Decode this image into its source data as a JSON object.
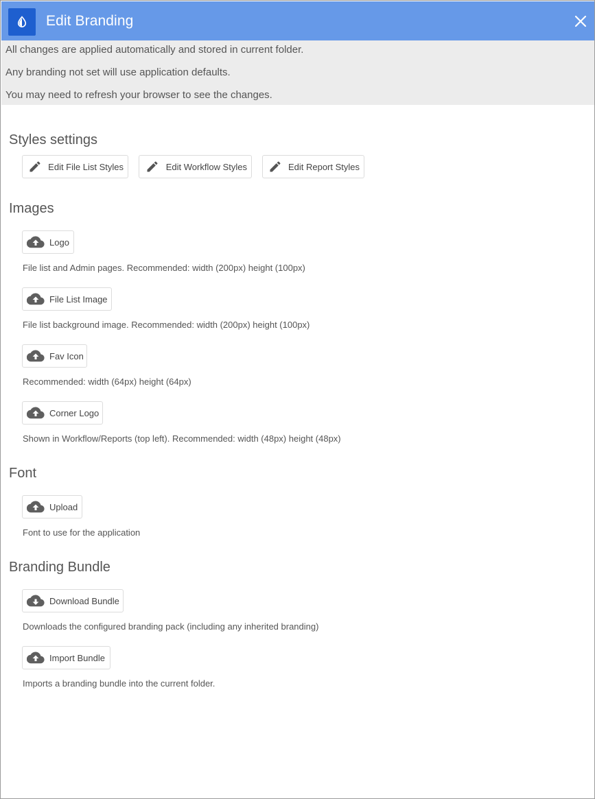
{
  "dialog": {
    "title": "Edit Branding",
    "app_icon": "water-drop-icon",
    "close_icon": "close-icon"
  },
  "notice": {
    "lines": [
      "All changes are applied automatically and stored in current folder.",
      "Any branding not set will use application defaults.",
      "You may need to refresh your browser to see the changes."
    ]
  },
  "styles": {
    "heading": "Styles settings",
    "buttons": [
      {
        "label": "Edit File List Styles",
        "icon": "pencil-icon"
      },
      {
        "label": "Edit Workflow Styles",
        "icon": "pencil-icon"
      },
      {
        "label": "Edit Report Styles",
        "icon": "pencil-icon"
      }
    ]
  },
  "images": {
    "heading": "Images",
    "items": [
      {
        "label": "Logo",
        "icon": "cloud-upload-icon",
        "hint": "File list and Admin pages. Recommended: width (200px) height (100px)"
      },
      {
        "label": "File List Image",
        "icon": "cloud-upload-icon",
        "hint": "File list background image. Recommended: width (200px) height (100px)"
      },
      {
        "label": "Fav Icon",
        "icon": "cloud-upload-icon",
        "hint": "Recommended: width (64px) height (64px)"
      },
      {
        "label": "Corner Logo",
        "icon": "cloud-upload-icon",
        "hint": "Shown in Workflow/Reports (top left). Recommended: width (48px) height (48px)"
      }
    ]
  },
  "font": {
    "heading": "Font",
    "items": [
      {
        "label": "Upload",
        "icon": "cloud-upload-icon",
        "hint": "Font to use for the application"
      }
    ]
  },
  "bundle": {
    "heading": "Branding Bundle",
    "items": [
      {
        "label": "Download Bundle",
        "icon": "cloud-download-icon",
        "hint": "Downloads the configured branding pack (including any inherited branding)"
      },
      {
        "label": "Import Bundle",
        "icon": "cloud-upload-icon",
        "hint": "Imports a branding bundle into the current folder."
      }
    ]
  },
  "colors": {
    "titlebar": "#6699e8",
    "app_icon_bg": "#1e5fcf",
    "notice_bg": "#ececec"
  }
}
